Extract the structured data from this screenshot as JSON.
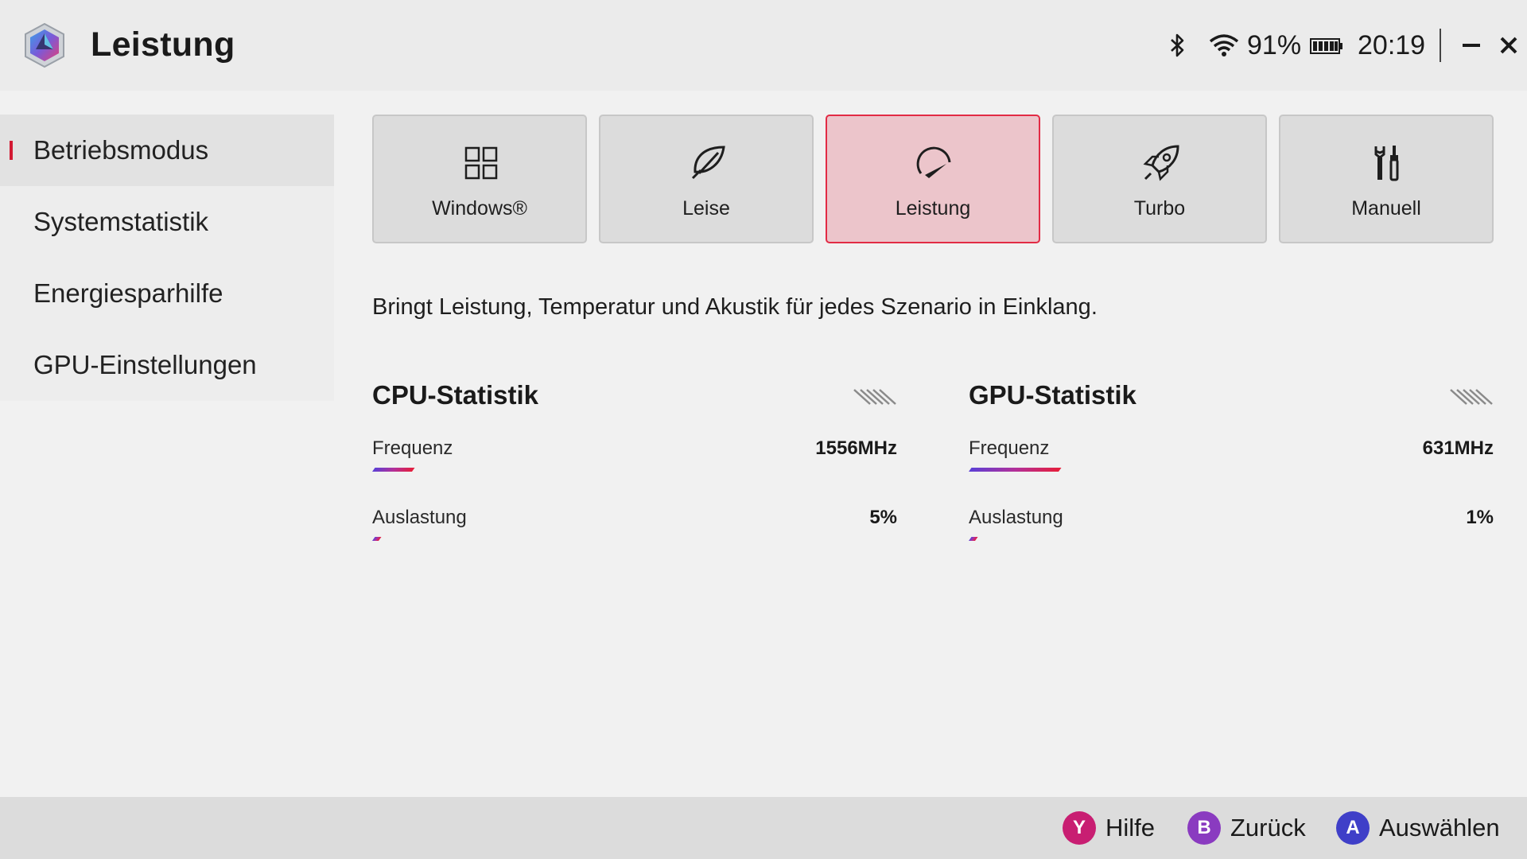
{
  "app": {
    "title": "Leistung",
    "logo_icon": "armoury-crate-logo-icon"
  },
  "status": {
    "bluetooth_icon": "bluetooth-icon",
    "wifi_icon": "wifi-icon",
    "battery_percent": "91%",
    "battery_icon": "battery-icon",
    "time": "20:19",
    "minimize_icon": "minimize-icon",
    "close_icon": "close-icon"
  },
  "sidebar": {
    "items": [
      {
        "label": "Betriebsmodus",
        "active": true
      },
      {
        "label": "Systemstatistik",
        "active": false
      },
      {
        "label": "Energiesparhilfe",
        "active": false
      },
      {
        "label": "GPU-Einstellungen",
        "active": false
      }
    ]
  },
  "modes": [
    {
      "label": "Windows®",
      "icon": "windows-grid-icon",
      "active": false
    },
    {
      "label": "Leise",
      "icon": "leaf-icon",
      "active": false
    },
    {
      "label": "Leistung",
      "icon": "gauge-icon",
      "active": true
    },
    {
      "label": "Turbo",
      "icon": "rocket-icon",
      "active": false
    },
    {
      "label": "Manuell",
      "icon": "tools-icon",
      "active": false
    }
  ],
  "description": "Bringt Leistung, Temperatur und Akustik für jedes Szenario in Einklang.",
  "stats": {
    "cpu": {
      "title": "CPU-Statistik",
      "frequency_label": "Frequenz",
      "frequency_value": "1556MHz",
      "frequency_fraction": 0.12,
      "load_label": "Auslastung",
      "load_value": "5%",
      "load_fraction": 0.02
    },
    "gpu": {
      "title": "GPU-Statistik",
      "frequency_label": "Frequenz",
      "frequency_value": "631MHz",
      "frequency_fraction": 0.27,
      "load_label": "Auslastung",
      "load_value": "1%",
      "load_fraction": 0.02
    }
  },
  "footer": {
    "actions": [
      {
        "key": "Y",
        "label": "Hilfe",
        "color": "#c81e72"
      },
      {
        "key": "B",
        "label": "Zurück",
        "color": "#8a3bc0"
      },
      {
        "key": "A",
        "label": "Auswählen",
        "color": "#3f3fc8"
      }
    ]
  },
  "colors": {
    "accent": "#e22b45",
    "active_card_bg": "#ecc5cb"
  }
}
